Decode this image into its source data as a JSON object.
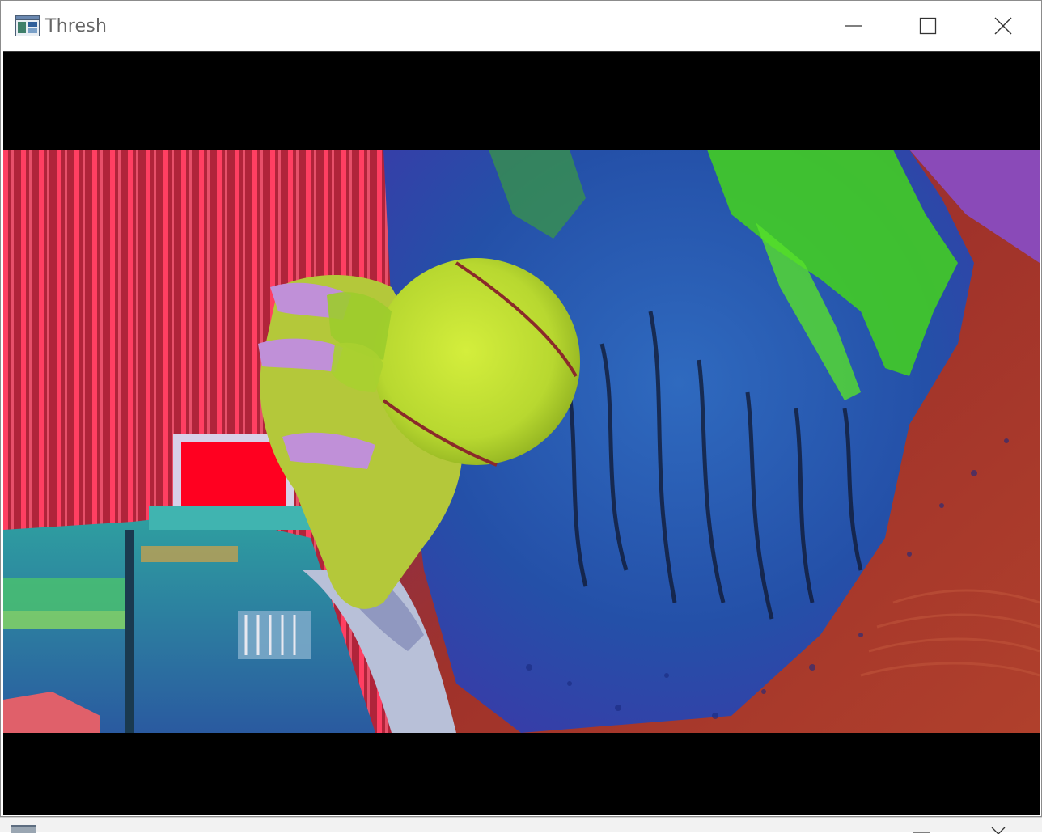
{
  "window": {
    "title": "Thresh",
    "app_icon": "opencv-window-icon",
    "controls": {
      "minimize_icon": "minimize-icon",
      "maximize_icon": "maximize-icon",
      "close_icon": "close-icon"
    }
  },
  "image": {
    "description_icon": "camera-frame-image",
    "colors": {
      "curtain_red": "#e0304c",
      "tennis_ball": "#c8e63a",
      "hair_blue": "#2a58b8",
      "hair_green": "#44d41c",
      "shirt_red": "#a0322a",
      "monitor_red": "#ff0020"
    }
  }
}
